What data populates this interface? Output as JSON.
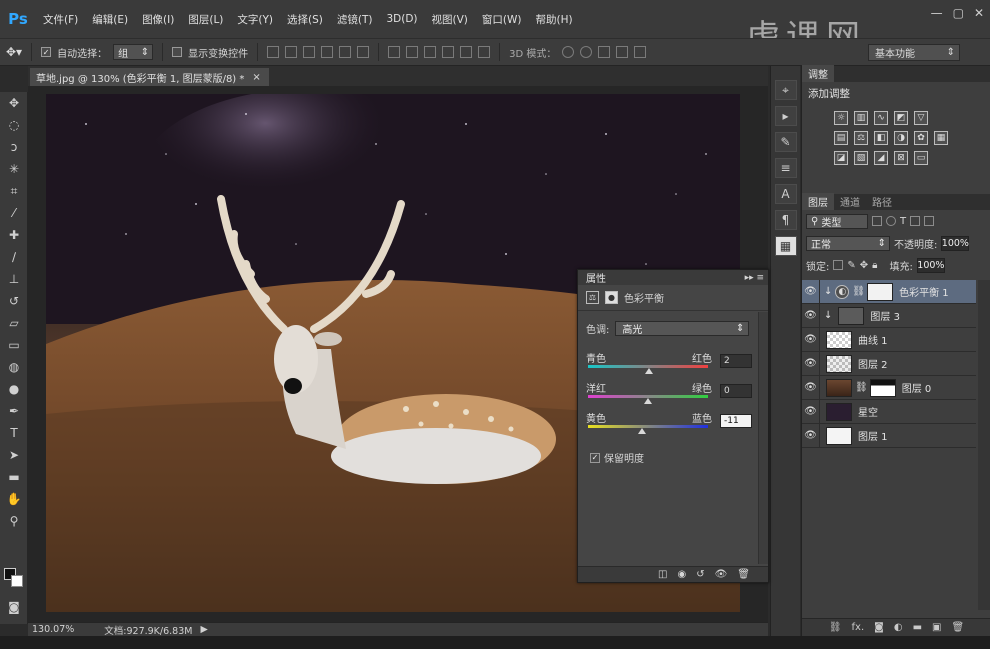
{
  "app": {
    "logo": "Ps"
  },
  "menu": [
    "文件(F)",
    "编辑(E)",
    "图像(I)",
    "图层(L)",
    "文字(Y)",
    "选择(S)",
    "滤镜(T)",
    "3D(D)",
    "视图(V)",
    "窗口(W)",
    "帮助(H)"
  ],
  "watermark": "虎课网",
  "options": {
    "auto_select_label": "自动选择：",
    "auto_select_value": "组",
    "show_transform_label": "显示变换控件",
    "mode3d_label": "3D 模式：",
    "workspace": "基本功能"
  },
  "document": {
    "tab_title": "草地.jpg @ 130% (色彩平衡 1, 图层蒙版/8) *",
    "zoom": "130.07%",
    "doc_size": "文档:927.9K/6.83M"
  },
  "adjustments": {
    "tab": "调整",
    "title": "添加调整"
  },
  "layers": {
    "tabs": [
      "图层",
      "通道",
      "路径"
    ],
    "filter": "类型",
    "blend_mode": "正常",
    "opacity_label": "不透明度:",
    "opacity": "100%",
    "lock_label": "锁定:",
    "fill_label": "填充:",
    "fill": "100%",
    "items": [
      {
        "name": "色彩平衡 1",
        "selected": true
      },
      {
        "name": "图层 3",
        "selected": false
      },
      {
        "name": "曲线 1",
        "selected": false
      },
      {
        "name": "图层 2",
        "selected": false
      },
      {
        "name": "图层 0",
        "selected": false
      },
      {
        "name": "星空",
        "selected": false
      },
      {
        "name": "图层 1",
        "selected": false
      }
    ]
  },
  "properties": {
    "tab": "属性",
    "title": "色彩平衡",
    "tone_label": "色调:",
    "tone_value": "高光",
    "sliders": [
      {
        "left": "青色",
        "right": "红色",
        "value": "2",
        "fraction": 0.51
      },
      {
        "left": "洋红",
        "right": "绿色",
        "value": "0",
        "fraction": 0.5
      },
      {
        "left": "黄色",
        "right": "蓝色",
        "value": "-11",
        "fraction": 0.45
      }
    ],
    "preserve_luminosity": "保留明度"
  }
}
